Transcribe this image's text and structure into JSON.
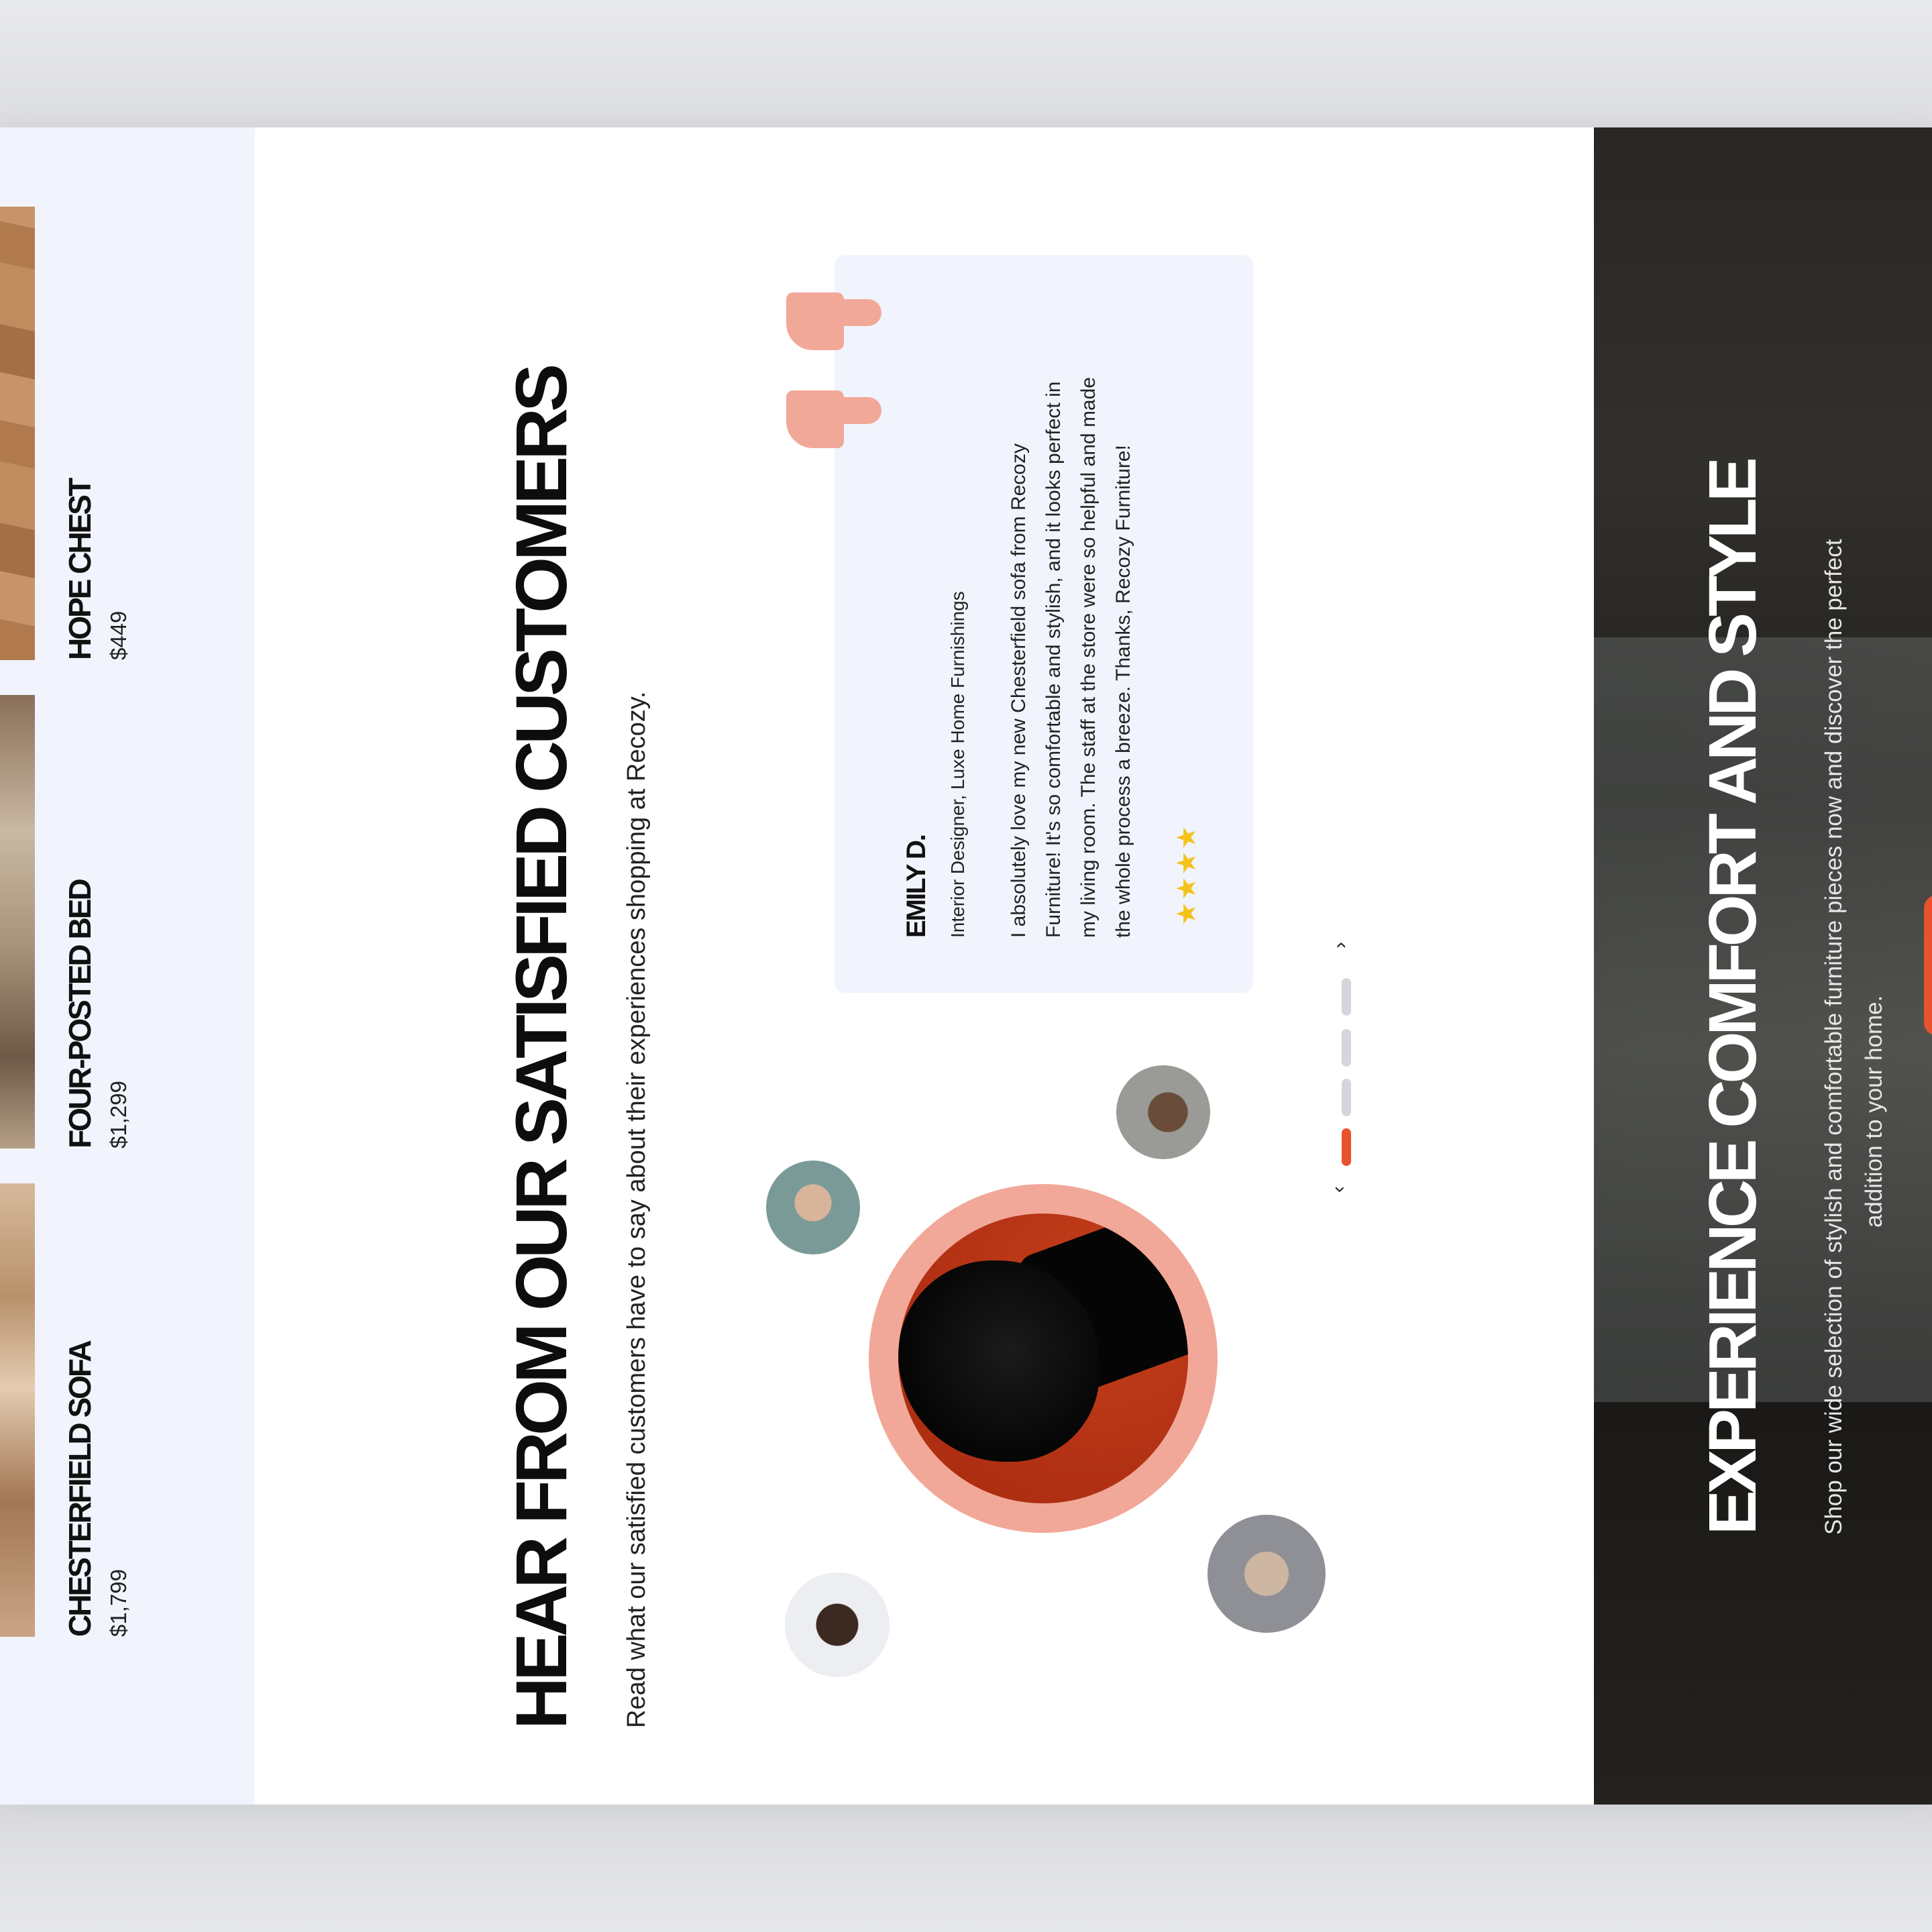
{
  "products": [
    {
      "name": "HOPE CHEST",
      "price": "$449"
    },
    {
      "name": "FOUR-POSTED BED",
      "price": "$1,299"
    },
    {
      "name": "CHESTERFIELD SOFA",
      "price": "$1,799"
    }
  ],
  "testimonials": {
    "title": "HEAR FROM OUR SATISFIED CUSTOMERS",
    "subtitle": "Read what our satisfied customers have to say about their experiences shopping at Recozy.",
    "review": {
      "name": "EMILY D.",
      "role": "Interior Designer, Luxe Home Furnishings",
      "lines": [
        "I absolutely love my new Chesterfield sofa from Recozy",
        "Furniture! It's so comfortable and stylish, and it looks perfect in",
        "my living room. The staff at the store were so helpful and made",
        "the whole process a breeze. Thanks, Recozy  Furniture!"
      ],
      "stars": "★★★★",
      "rating": 4
    },
    "pager": {
      "total": 4,
      "active": 4,
      "up_icon": "chevron-up-icon",
      "down_icon": "chevron-down-icon"
    }
  },
  "hero": {
    "title": "EXPERIENCE COMFORT AND STYLE",
    "subtitle_lines": [
      "Shop our wide selection of stylish and comfortable furniture pieces now and discover the perfect",
      "addition to your home."
    ]
  },
  "colors": {
    "accent": "#e8532c",
    "accent_soft": "#f2a898",
    "panel": "#f1f4fc",
    "star": "#f4c21a"
  }
}
